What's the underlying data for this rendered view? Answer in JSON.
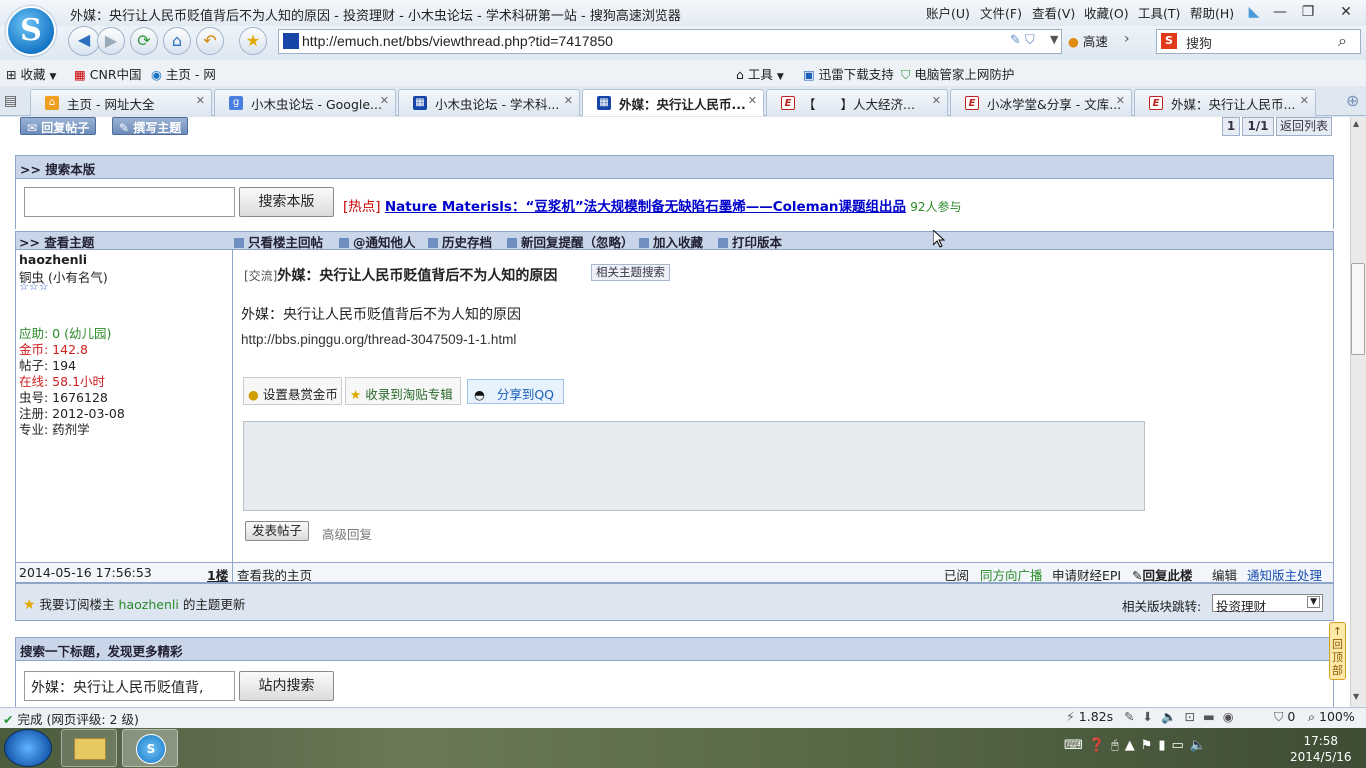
{
  "window": {
    "title": "外媒：央行让人民币贬值背后不为人知的原因 - 投资理财 - 小木虫论坛 - 学术科研第一站 - 搜狗高速浏览器",
    "logo_letter": "S",
    "menus": [
      "账户(U)",
      "文件(F)",
      "查看(V)",
      "收藏(O)",
      "工具(T)",
      "帮助(H)"
    ]
  },
  "navbar": {
    "url": "http://emuch.net/bbs/viewthread.php?tid=7417850",
    "speed_label": "高速",
    "search_placeholder": "搜狗"
  },
  "bookmarks": {
    "left": [
      "收藏",
      "CNR中国",
      "主页 - 网"
    ],
    "right": [
      "工具",
      "迅雷下载支持",
      "电脑管家上网防护"
    ]
  },
  "tabs": [
    {
      "label": "主页 - 网址大全",
      "color": "#f0a020",
      "icon": "home-icon"
    },
    {
      "label": "小木虫论坛 - Google...",
      "color": "#4a7fe0",
      "icon": "google-icon"
    },
    {
      "label": "小木虫论坛 - 学术科...",
      "color": "#1745a8",
      "icon": "emuch-icon"
    },
    {
      "label": "外媒：央行让人民币...",
      "color": "#1745a8",
      "icon": "emuch-icon"
    },
    {
      "label": "【　　】人大经济...",
      "color": "#c02020",
      "icon": "pinggu-icon"
    },
    {
      "label": "小冰学堂&分享 - 文库...",
      "color": "#c02020",
      "icon": "pinggu-icon"
    },
    {
      "label": "外媒：央行让人民币...",
      "color": "#c02020",
      "icon": "pinggu-icon"
    }
  ],
  "top_buttons": {
    "reply": "回复帖子",
    "new_topic": "撰写主题"
  },
  "pager": {
    "current": "1",
    "total": "1/1",
    "back": "返回列表"
  },
  "board_search": {
    "header": ">> 搜索本版",
    "button": "搜索本版",
    "hot_tag": "[热点]",
    "hot_link": "Nature Materisls：“豆浆机”法大规模制备无缺陷石墨烯——Coleman课题组出品",
    "hot_count": "92人参与"
  },
  "thread_toolbar": {
    "header": ">> 查看主题",
    "links": [
      "只看楼主回帖",
      "@通知他人",
      "历史存档",
      "新回复提醒（忽略）",
      "加入收藏",
      "打印版本"
    ]
  },
  "user": {
    "name": "haozhenli",
    "rank": "铜虫 (小有名气)",
    "stars": "☆☆☆",
    "help": "应助: 0 (幼儿园)",
    "coins": "金币: 142.8",
    "posts": "帖子: 194",
    "online": "在线: 58.1小时",
    "uid": "虫号: 1676128",
    "register": "注册: 2012-03-08",
    "major": "专业: 药剂学"
  },
  "post": {
    "tag": "[交流]",
    "title": "外媒：央行让人民币贬值背后不为人知的原因",
    "related_button": "相关主题搜索",
    "body": "外媒：央行让人民币贬值背后不为人知的原因",
    "link": "http://bbs.pinggu.org/thread-3047509-1-1.html",
    "actions": [
      "设置悬赏金币",
      "收录到淘贴专辑",
      "分享到QQ"
    ],
    "submit": "发表帖子",
    "advanced": "高级回复"
  },
  "post_footer": {
    "date": "2014-05-16 17:56:53",
    "floor": "1楼",
    "home": "查看我的主页",
    "right": [
      "已阅",
      "同方向广播",
      "申请财经EPI",
      "回复此楼",
      "编辑",
      "通知版主处理"
    ]
  },
  "subscribe": {
    "prefix": "我要订阅楼主",
    "user": "haozhenli",
    "suffix": "的主题更新",
    "jump_label": "相关版块跳转:",
    "jump_value": "投资理财"
  },
  "bottom_search": {
    "header": "搜索一下标题，发现更多精彩",
    "value": "外媒：央行让人民币贬值背,",
    "button": "站内搜索"
  },
  "back_to_top": "回顶部",
  "statusbar": {
    "done": "完成",
    "rating": "(网页评级: 2 级)",
    "speed": "1.82s",
    "count": "0",
    "zoom": "100%"
  },
  "taskbar": {
    "time": "17:58",
    "date": "2014/5/16"
  }
}
